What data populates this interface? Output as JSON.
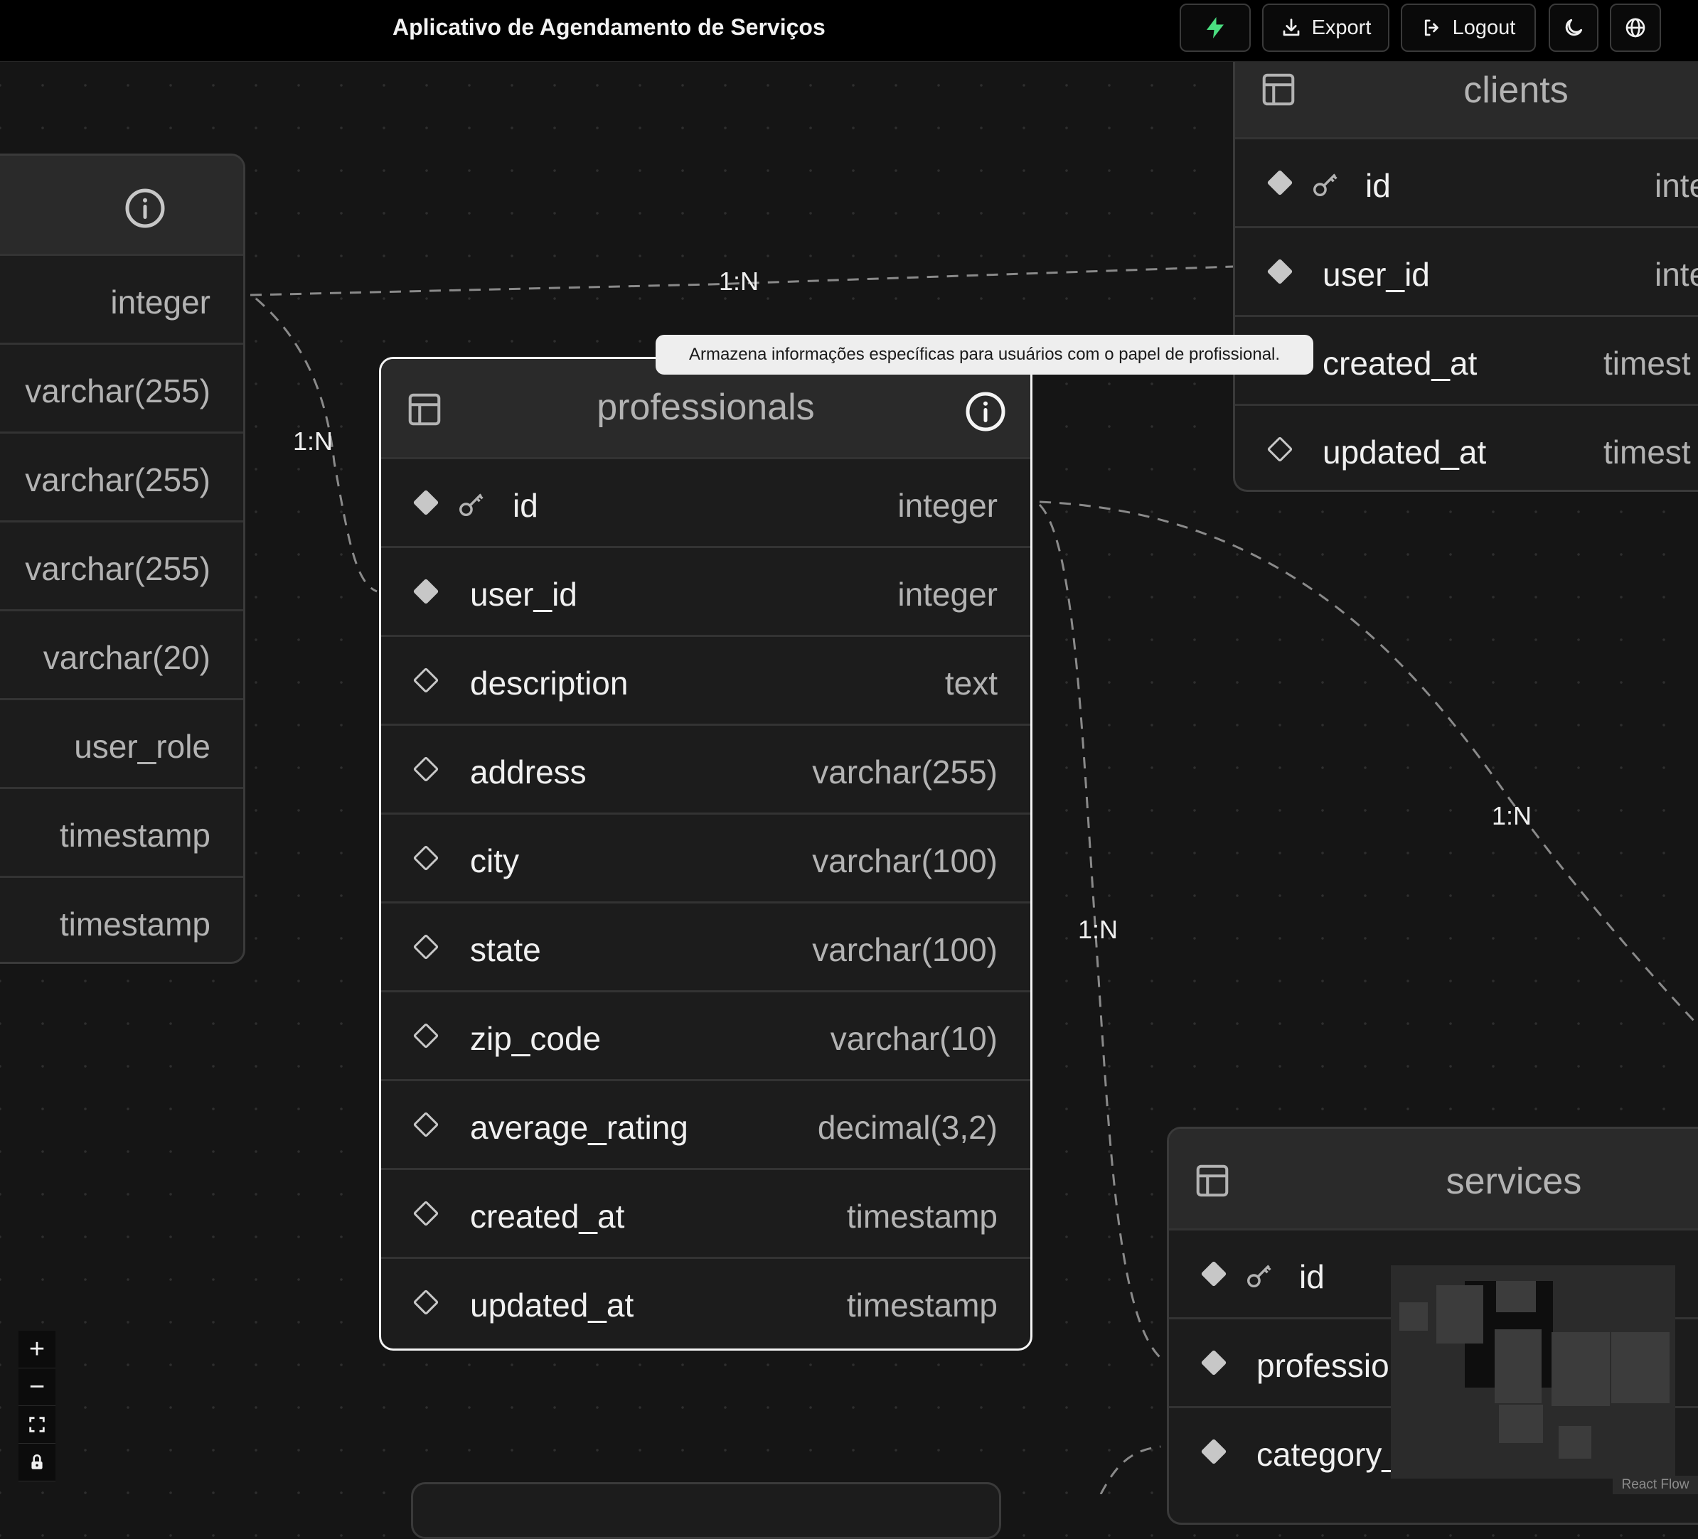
{
  "header": {
    "title": "Aplicativo de Agendamento de Serviços",
    "export_label": "Export",
    "logout_label": "Logout"
  },
  "colors": {
    "accent": "#4ade80",
    "node_bg": "#1c1c1c",
    "node_header": "#2a2a2a",
    "selected_border": "#f4f4f4"
  },
  "users_table": {
    "types": [
      "integer",
      "varchar(255)",
      "varchar(255)",
      "varchar(255)",
      "varchar(20)",
      "user_role",
      "timestamp",
      "timestamp"
    ]
  },
  "professionals_table": {
    "title": "professionals",
    "tooltip": "Armazena informações específicas para usuários com o papel de profissional.",
    "fields": [
      {
        "name": "id",
        "type": "integer"
      },
      {
        "name": "user_id",
        "type": "integer"
      },
      {
        "name": "description",
        "type": "text"
      },
      {
        "name": "address",
        "type": "varchar(255)"
      },
      {
        "name": "city",
        "type": "varchar(100)"
      },
      {
        "name": "state",
        "type": "varchar(100)"
      },
      {
        "name": "zip_code",
        "type": "varchar(10)"
      },
      {
        "name": "average_rating",
        "type": "decimal(3,2)"
      },
      {
        "name": "created_at",
        "type": "timestamp"
      },
      {
        "name": "updated_at",
        "type": "timestamp"
      }
    ]
  },
  "clients_table": {
    "title": "clients",
    "fields": [
      {
        "name": "id",
        "type": "inte"
      },
      {
        "name": "user_id",
        "type": "inte"
      },
      {
        "name": "created_at",
        "type": "timest"
      },
      {
        "name": "updated_at",
        "type": "timest"
      }
    ]
  },
  "services_table": {
    "title": "services",
    "fields": [
      {
        "name": "id"
      },
      {
        "name": "professio"
      },
      {
        "name": "category_"
      }
    ]
  },
  "edge_labels": [
    "1:N",
    "1:N",
    "1:N",
    "1:N"
  ],
  "controls": {
    "zoom_in": "+",
    "zoom_out": "−"
  },
  "attribution": "React Flow"
}
